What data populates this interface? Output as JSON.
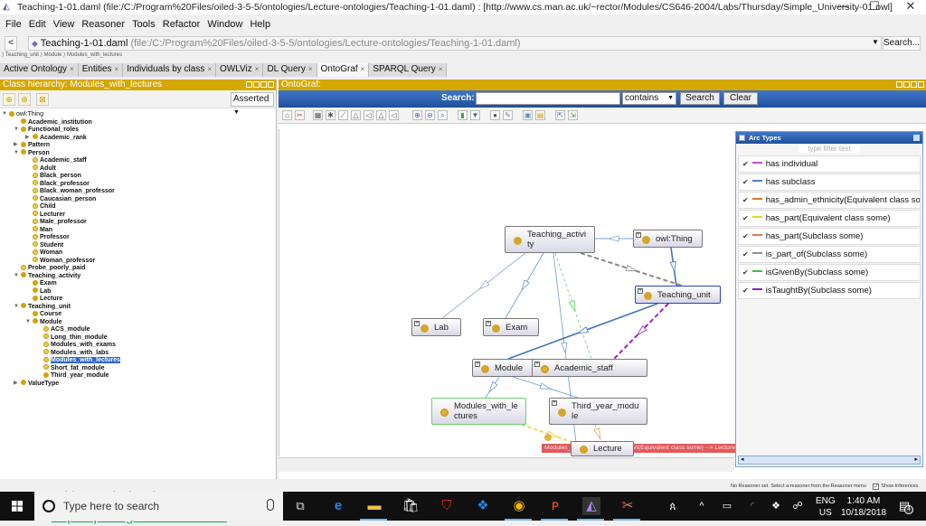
{
  "window": {
    "title": "Teaching-1-01.daml (file:/C:/Program%20Files/oiled-3-5-5/ontologies/Lecture-ontologies/Teaching-1-01.daml)  : [http://www.cs.man.ac.uk/~rector/Modules/CS646-2004/Labs/Thursday/Simple_University-01.owl]",
    "minimize": "—",
    "maximize": "☐",
    "close": "✕"
  },
  "menu": [
    "File",
    "Edit",
    "View",
    "Reasoner",
    "Tools",
    "Refactor",
    "Window",
    "Help"
  ],
  "address": {
    "back": "<",
    "file_name": "Teaching-1-01.daml",
    "file_path": "(file:/C:/Program%20Files/oiled-3-5-5/ontologies/Lecture-ontologies/Teaching-1-01.daml)",
    "search_label": "Search..."
  },
  "breadcrumb": "⟩ Teaching_unit ⟩ Module ⟩ Modules_with_lectures",
  "tabs": [
    {
      "label": "Active Ontology"
    },
    {
      "label": "Entities"
    },
    {
      "label": "Individuals by class"
    },
    {
      "label": "OWLViz"
    },
    {
      "label": "DL Query"
    },
    {
      "label": "OntoGraf",
      "active": true
    },
    {
      "label": "SPARQL Query"
    }
  ],
  "class_hierarchy": {
    "title": "Class hierarchy: Modules_with_lectures",
    "mode": "Asserted",
    "nodes": [
      {
        "label": "owl:Thing",
        "depth": 0,
        "toggle": "▼"
      },
      {
        "label": "Academic_institution",
        "depth": 1
      },
      {
        "label": "Functional_roles",
        "depth": 1,
        "toggle": "▼"
      },
      {
        "label": "Academic_rank",
        "depth": 2,
        "toggle": "▶"
      },
      {
        "label": "Pattern",
        "depth": 1,
        "toggle": "▶"
      },
      {
        "label": "Person",
        "depth": 1,
        "toggle": "▼"
      },
      {
        "label": "Academic_staff",
        "depth": 2,
        "defined": true
      },
      {
        "label": "Adult",
        "depth": 2,
        "defined": true
      },
      {
        "label": "Black_person",
        "depth": 2,
        "defined": true
      },
      {
        "label": "Black_professor",
        "depth": 2,
        "defined": true
      },
      {
        "label": "Black_woman_professor",
        "depth": 2,
        "defined": true
      },
      {
        "label": "Caucasian_person",
        "depth": 2,
        "defined": true
      },
      {
        "label": "Child",
        "depth": 2,
        "defined": true
      },
      {
        "label": "Lecturer",
        "depth": 2,
        "defined": true
      },
      {
        "label": "Male_professor",
        "depth": 2,
        "defined": true
      },
      {
        "label": "Man",
        "depth": 2,
        "defined": true
      },
      {
        "label": "Professor",
        "depth": 2,
        "defined": true
      },
      {
        "label": "Student",
        "depth": 2,
        "defined": true
      },
      {
        "label": "Woman",
        "depth": 2,
        "defined": true
      },
      {
        "label": "Woman_professor",
        "depth": 2,
        "defined": true
      },
      {
        "label": "Probe_poorly_paid",
        "depth": 1,
        "defined": true
      },
      {
        "label": "Teaching_activity",
        "depth": 1,
        "toggle": "▼"
      },
      {
        "label": "Exam",
        "depth": 2
      },
      {
        "label": "Lab",
        "depth": 2
      },
      {
        "label": "Lecture",
        "depth": 2
      },
      {
        "label": "Teaching_unit",
        "depth": 1,
        "toggle": "▼"
      },
      {
        "label": "Course",
        "depth": 2
      },
      {
        "label": "Module",
        "depth": 2,
        "toggle": "▼"
      },
      {
        "label": "ACS_module",
        "depth": 3,
        "defined": true
      },
      {
        "label": "Long_thin_module",
        "depth": 3,
        "defined": true
      },
      {
        "label": "Modules_with_exams",
        "depth": 3,
        "defined": true
      },
      {
        "label": "Modules_with_labs",
        "depth": 3,
        "defined": true
      },
      {
        "label": "Modules_with_lectures",
        "depth": 3,
        "defined": true,
        "selected": true
      },
      {
        "label": "Short_fat_module",
        "depth": 3,
        "defined": true
      },
      {
        "label": "Third_year_module",
        "depth": 3
      },
      {
        "label": "ValueType",
        "depth": 1,
        "toggle": "▶"
      }
    ]
  },
  "promo": {
    "line1": "With Protégé software:",
    "link": "https://protege.stanford.edu/"
  },
  "ontograf": {
    "title": "OntoGraf:",
    "search_label": "Search:",
    "search_value": "",
    "match_mode": "contains",
    "search_button": "Search",
    "clear_button": "Clear",
    "nodes": [
      {
        "id": "teaching_activity",
        "label": "Teaching_activi\nty"
      },
      {
        "id": "owl_thing",
        "label": "owl:Thing"
      },
      {
        "id": "teaching_unit",
        "label": "Teaching_unit"
      },
      {
        "id": "lab",
        "label": "Lab"
      },
      {
        "id": "exam",
        "label": "Exam"
      },
      {
        "id": "module",
        "label": "Module"
      },
      {
        "id": "academic_staff",
        "label": "Academic_staff"
      },
      {
        "id": "modules_with_lectures",
        "label": "Modules_with_le\nctures"
      },
      {
        "id": "third_year_module",
        "label": "Third_year_modu\nle"
      },
      {
        "id": "lecture",
        "label": "Lecture"
      }
    ],
    "tooltip": "Modules_with_lectures -- has_part(Equivalent class some) --> Lecture"
  },
  "arc_types": {
    "title": "Arc Types",
    "filter_placeholder": "type filter text",
    "items": [
      {
        "label": "has individual",
        "color": "#c050d0",
        "checked": true
      },
      {
        "label": "has subclass",
        "color": "#4a7fc0",
        "checked": true
      },
      {
        "label": "has_admin_ethnicity(Equivalent class som",
        "color": "#e07030",
        "checked": true
      },
      {
        "label": "has_part(Equivalent class some)",
        "color": "#f0d030",
        "checked": true
      },
      {
        "label": "has_part(Subclass some)",
        "color": "#d08050",
        "checked": true
      },
      {
        "label": "is_part_of(Subclass some)",
        "color": "#909090",
        "checked": true
      },
      {
        "label": "isGivenBy(Subclass some)",
        "color": "#40c040",
        "checked": true
      },
      {
        "label": "isTaughtBy(Subclass some)",
        "color": "#9020c0",
        "checked": true
      }
    ]
  },
  "status": {
    "text": "No Reasoner set. Select a reasoner from the Reasoner menu",
    "show_inferences": "Show Inferences"
  },
  "taskbar": {
    "search_placeholder": "Type here to search",
    "lang": "ENG",
    "region": "US",
    "time": "1:40 AM",
    "date": "10/18/2018",
    "notifications": "4"
  }
}
